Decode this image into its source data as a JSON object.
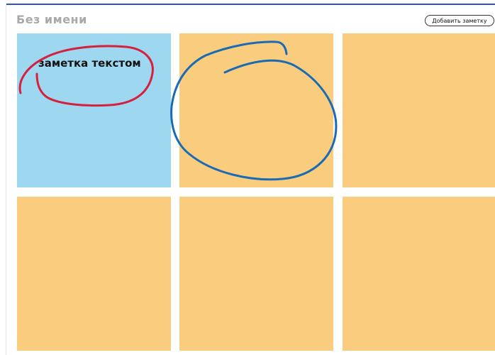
{
  "board": {
    "title": "Без имени",
    "add_button_label": "Добавить заметку"
  },
  "colors": {
    "accent": "#2b56c8",
    "note_default": "#f9cc7e",
    "note_blue": "#9dd7f0",
    "ink_red": "#d4213d",
    "ink_blue": "#1a6bb5"
  },
  "notes": [
    {
      "id": "note-1",
      "color": "blue",
      "text": "заметка текстом"
    },
    {
      "id": "note-2",
      "color": "orange",
      "text": ""
    },
    {
      "id": "note-3",
      "color": "orange",
      "text": ""
    },
    {
      "id": "note-4",
      "color": "orange",
      "text": ""
    },
    {
      "id": "note-5",
      "color": "orange",
      "text": ""
    },
    {
      "id": "note-6",
      "color": "orange",
      "text": ""
    }
  ]
}
